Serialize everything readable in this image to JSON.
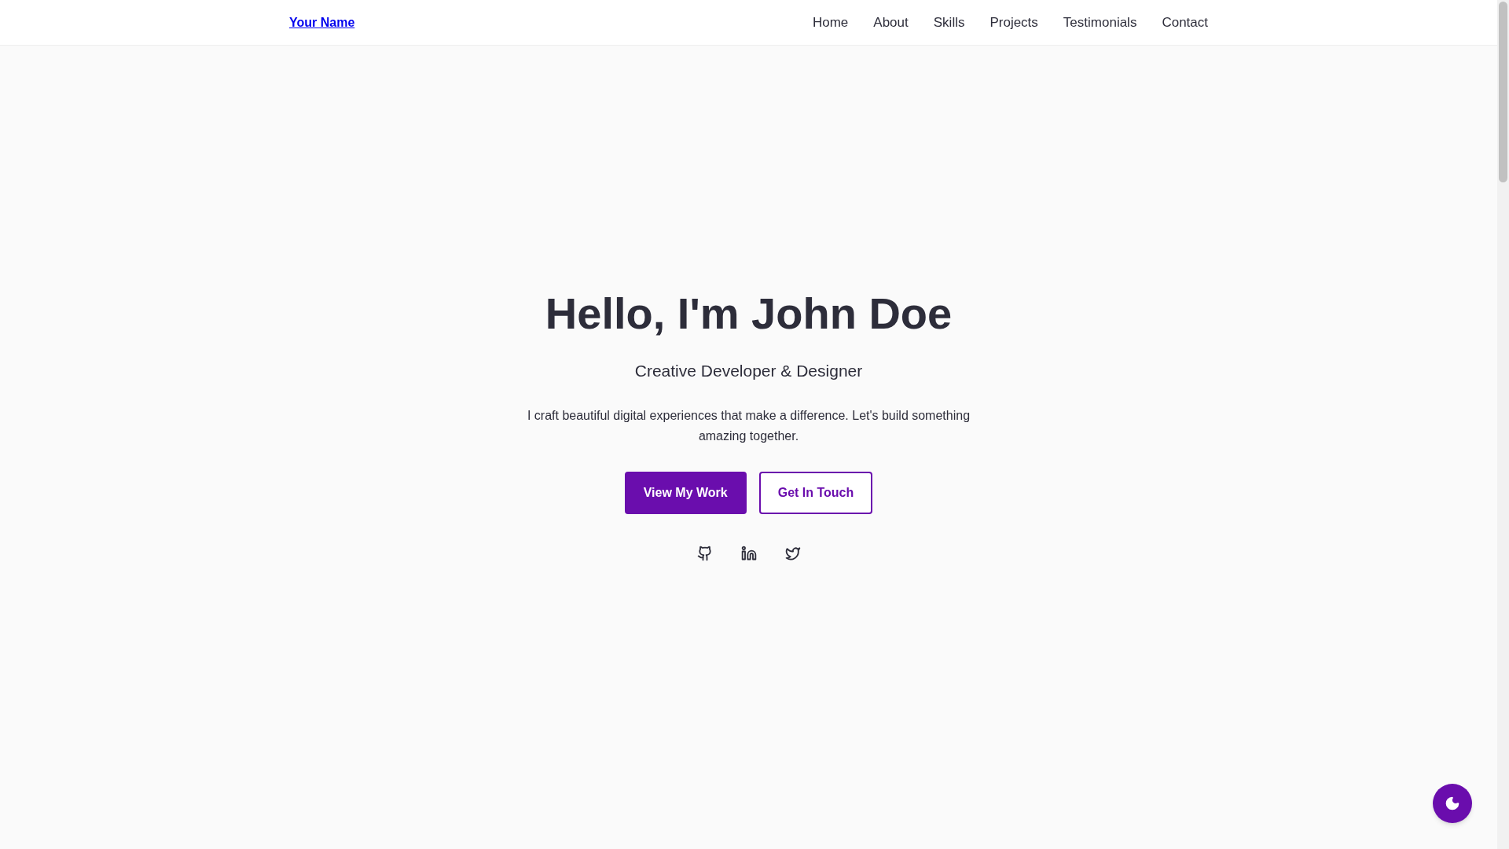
{
  "nav": {
    "brand": "Your Name",
    "links": [
      "Home",
      "About",
      "Skills",
      "Projects",
      "Testimonials",
      "Contact"
    ]
  },
  "hero": {
    "title": "Hello, I'm John Doe",
    "subtitle": "Creative Developer & Designer",
    "text": "I craft beautiful digital experiences that make a difference. Let's build something amazing together.",
    "buttons": [
      {
        "label": "View My Work",
        "kind": "primary"
      },
      {
        "label": "Get In Touch",
        "kind": "outline"
      }
    ],
    "social": [
      {
        "kind": "github"
      },
      {
        "kind": "linkedin"
      },
      {
        "kind": "twitter"
      }
    ]
  },
  "theme_toggle": {
    "kind": "moon"
  }
}
